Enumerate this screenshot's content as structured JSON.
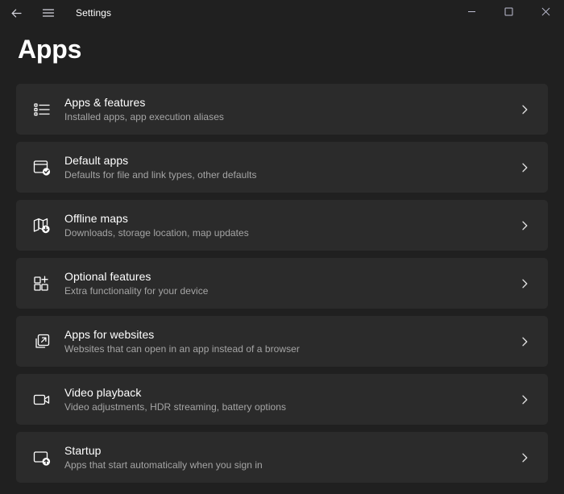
{
  "titlebar": {
    "back_icon": "back-arrow-icon",
    "menu_icon": "hamburger-menu-icon",
    "title": "Settings",
    "minimize_label": "Minimize",
    "maximize_label": "Maximize",
    "close_label": "Close"
  },
  "page": {
    "heading": "Apps",
    "background_color": "#202020",
    "card_color": "#2b2b2b",
    "title_color": "#ffffff",
    "subtitle_color": "#a5a5a5"
  },
  "items": [
    {
      "icon": "apps-list-icon",
      "title": "Apps & features",
      "subtitle": "Installed apps, app execution aliases",
      "chevron": "chevron-right-icon"
    },
    {
      "icon": "default-apps-window-check-icon",
      "title": "Default apps",
      "subtitle": "Defaults for file and link types, other defaults",
      "chevron": "chevron-right-icon"
    },
    {
      "icon": "offline-maps-download-icon",
      "title": "Offline maps",
      "subtitle": "Downloads, storage location, map updates",
      "chevron": "chevron-right-icon"
    },
    {
      "icon": "optional-features-grid-plus-icon",
      "title": "Optional features",
      "subtitle": "Extra functionality for your device",
      "chevron": "chevron-right-icon"
    },
    {
      "icon": "apps-for-websites-external-link-icon",
      "title": "Apps for websites",
      "subtitle": "Websites that can open in an app instead of a browser",
      "chevron": "chevron-right-icon"
    },
    {
      "icon": "video-playback-camera-icon",
      "title": "Video playback",
      "subtitle": "Video adjustments, HDR streaming, battery options",
      "chevron": "chevron-right-icon"
    },
    {
      "icon": "startup-monitor-up-arrow-icon",
      "title": "Startup",
      "subtitle": "Apps that start automatically when you sign in",
      "chevron": "chevron-right-icon"
    }
  ]
}
